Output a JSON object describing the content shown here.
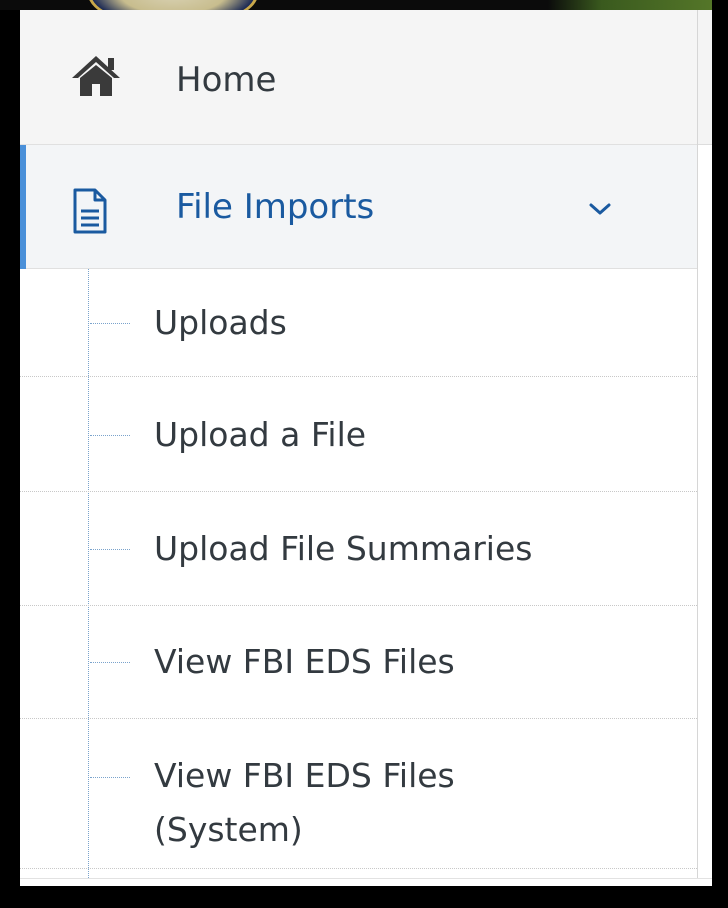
{
  "sidebar": {
    "home": {
      "label": "Home",
      "icon": "home-icon"
    },
    "file_imports": {
      "label": "File Imports",
      "icon": "file-text-icon",
      "expanded": true,
      "accent_color": "#4a90d9",
      "label_color": "#1a5aa0"
    },
    "submenu": [
      {
        "label": "Uploads"
      },
      {
        "label": "Upload a File"
      },
      {
        "label": "Upload File Summaries"
      },
      {
        "label": "View FBI EDS Files"
      },
      {
        "label": "View FBI EDS Files (System)"
      }
    ]
  },
  "colors": {
    "text": "#333a40",
    "border": "#e0e0e0",
    "tree_line": "#7aa3cc"
  }
}
